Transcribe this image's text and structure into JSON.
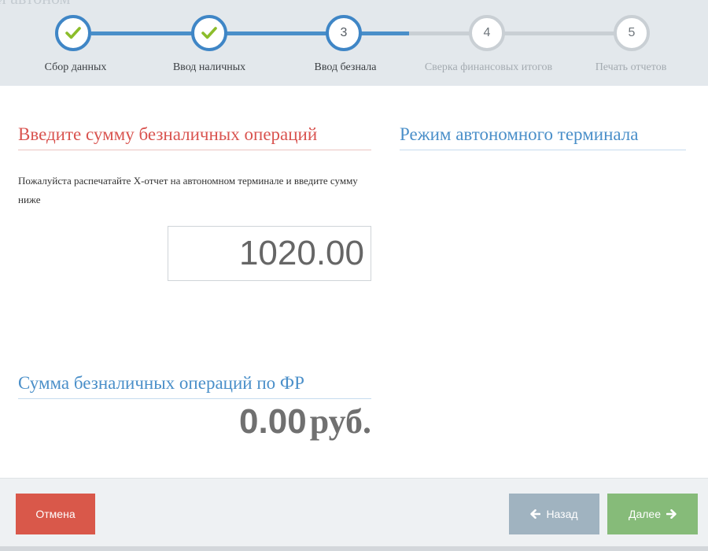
{
  "header": {
    "clipped_title": "и автоном"
  },
  "wizard": {
    "steps": [
      {
        "number": "1",
        "label": "Сбор данных",
        "state": "done",
        "icon": "check-icon"
      },
      {
        "number": "2",
        "label": "Ввод наличных",
        "state": "done",
        "icon": "check-icon"
      },
      {
        "number": "3",
        "label": "Ввод безнала",
        "state": "active"
      },
      {
        "number": "4",
        "label": "Сверка финансовых итогов",
        "state": "todo"
      },
      {
        "number": "5",
        "label": "Печать отчетов",
        "state": "todo"
      }
    ],
    "colors": {
      "done": "#3f86c6",
      "todo": "#c9cfd4",
      "check": "#8cbd2b"
    }
  },
  "main": {
    "cashless_heading": "Введите сумму безналичных операций",
    "instruction": "Пожалуйста распечатайте Х-отчет на автономном терминале и введите сумму ниже",
    "amount_value": "1020.00",
    "terminal_heading": "Режим автономного терминала",
    "fr_heading": "Сумма безналичных операций по ФР",
    "fr_amount": "0.00",
    "fr_currency": "руб."
  },
  "footer": {
    "cancel_label": "Отмена",
    "back_label": "Назад",
    "next_label": "Далее",
    "back_icon": "arrow-left-icon",
    "next_icon": "arrow-right-icon",
    "colors": {
      "cancel": "#d9584a",
      "back": "#a0b3c0",
      "next": "#86bb79"
    }
  }
}
